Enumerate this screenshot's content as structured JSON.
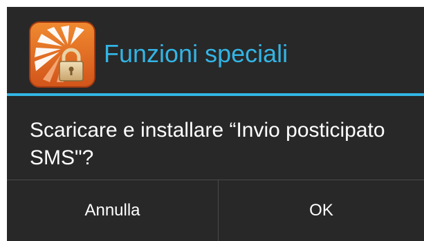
{
  "dialog": {
    "title": "Funzioni speciali",
    "icon": "app-lock-icon",
    "message": "Scaricare e installare “Invio posticipato SMS\"?",
    "buttons": {
      "cancel_label": "Annulla",
      "ok_label": "OK"
    }
  },
  "colors": {
    "accent": "#33b5e5",
    "background": "#282828",
    "text": "#ffffff"
  }
}
